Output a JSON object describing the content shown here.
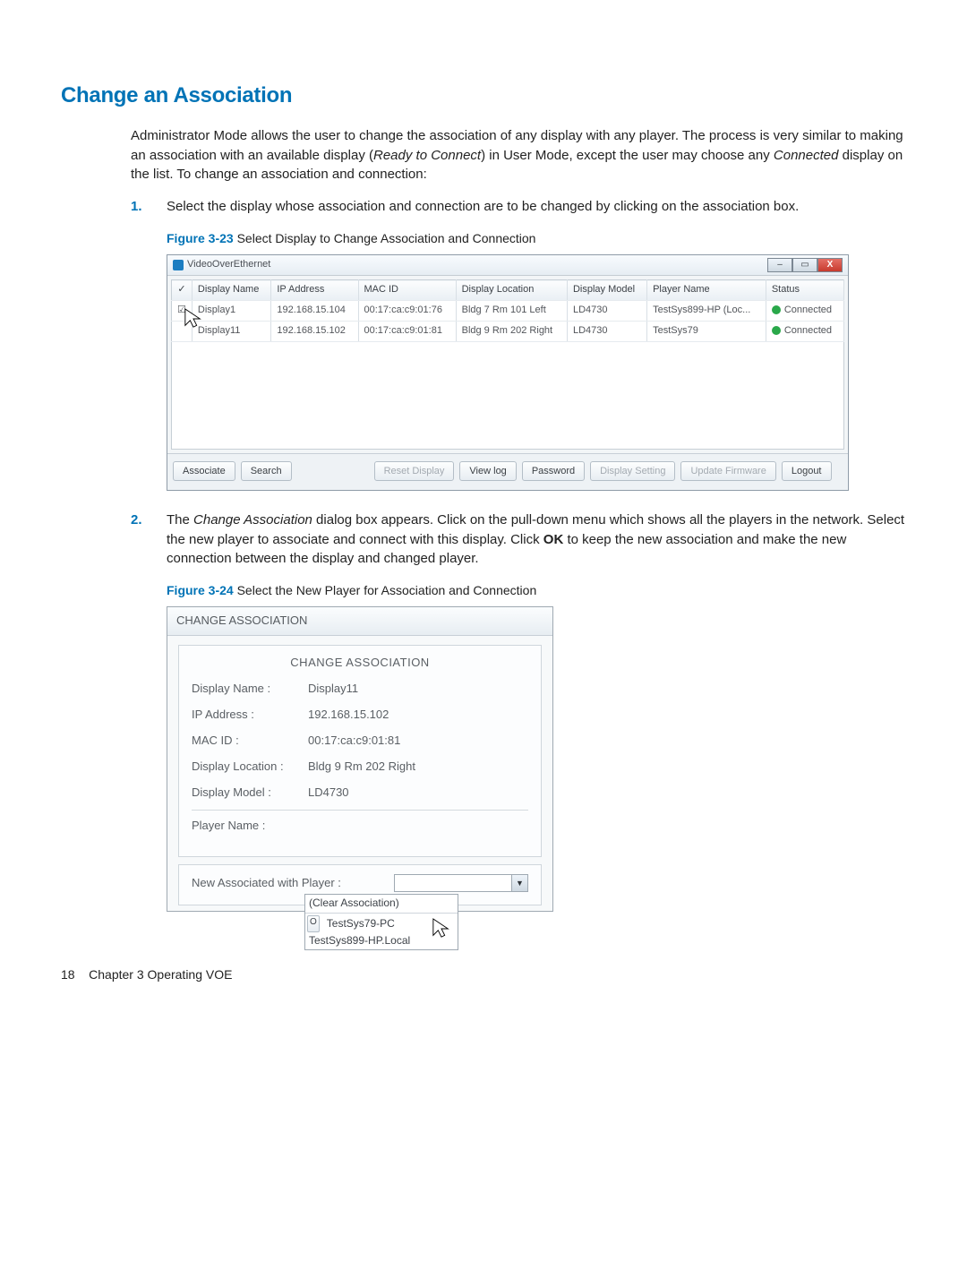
{
  "section_title": "Change an Association",
  "intro_text_1": "Administrator Mode allows the user to change the association of any display with any player. The process is very similar to making an association with an available display (",
  "intro_italic_1": "Ready to Connect",
  "intro_text_2": ") in User Mode, except the user may choose any ",
  "intro_italic_2": "Connected",
  "intro_text_3": " display on the list. To change an association and connection:",
  "step1_num": "1.",
  "step1_text": "Select the display whose association and connection are to be changed by clicking on the association box.",
  "fig23_label": "Figure 3-23",
  "fig23_text": "  Select Display to Change Association and Connection",
  "voe": {
    "title": "VideoOverEthernet",
    "headers": {
      "chk": "✓",
      "name": "Display Name",
      "ip": "IP Address",
      "mac": "MAC ID",
      "loc": "Display Location",
      "model": "Display Model",
      "player": "Player Name",
      "status": "Status"
    },
    "rows": [
      {
        "chk": "☑",
        "name": "Display1",
        "ip": "192.168.15.104",
        "mac": "00:17:ca:c9:01:76",
        "loc": "Bldg 7 Rm 101 Left",
        "model": "LD4730",
        "player": "TestSys899-HP (Loc...",
        "status": "Connected"
      },
      {
        "chk": "",
        "name": "Display11",
        "ip": "192.168.15.102",
        "mac": "00:17:ca:c9:01:81",
        "loc": "Bldg 9 Rm 202 Right",
        "model": "LD4730",
        "player": "TestSys79",
        "status": "Connected"
      }
    ],
    "buttons": {
      "associate": "Associate",
      "search": "Search",
      "reset": "Reset Display",
      "viewlog": "View log",
      "password": "Password",
      "dispset": "Display Setting",
      "updfw": "Update Firmware",
      "logout": "Logout"
    }
  },
  "step2_num": "2.",
  "step2_text_1": "The ",
  "step2_italic_1": "Change Association",
  "step2_text_2": " dialog box appears. Click on the pull-down menu which shows all the players in the network. Select the new player to associate and connect with this display. Click ",
  "step2_bold_1": "OK",
  "step2_text_3": " to keep the new association and make the new connection between the display and changed player.",
  "fig24_label": "Figure 3-24",
  "fig24_text": "  Select the New Player for Association and Connection",
  "assoc": {
    "win_title": "CHANGE ASSOCIATION",
    "inner_title": "CHANGE ASSOCIATION",
    "display_name_lbl": "Display Name :",
    "display_name_val": "Display11",
    "ip_lbl": "IP Address :",
    "ip_val": "192.168.15.102",
    "mac_lbl": "MAC ID :",
    "mac_val": "00:17:ca:c9:01:81",
    "loc_lbl": "Display Location :",
    "loc_val": "Bldg 9 Rm 202 Right",
    "model_lbl": "Display Model :",
    "model_val": "LD4730",
    "player_lbl": "Player Name :",
    "player_val": "",
    "combo_label": "New Associated with Player :",
    "options": {
      "clear": "(Clear Association)",
      "opt1": "TestSys79-PC",
      "opt2": "TestSys899-HP.Local"
    },
    "ok_btn": "O"
  },
  "footer_page": "18",
  "footer_text": "Chapter 3   Operating VOE"
}
